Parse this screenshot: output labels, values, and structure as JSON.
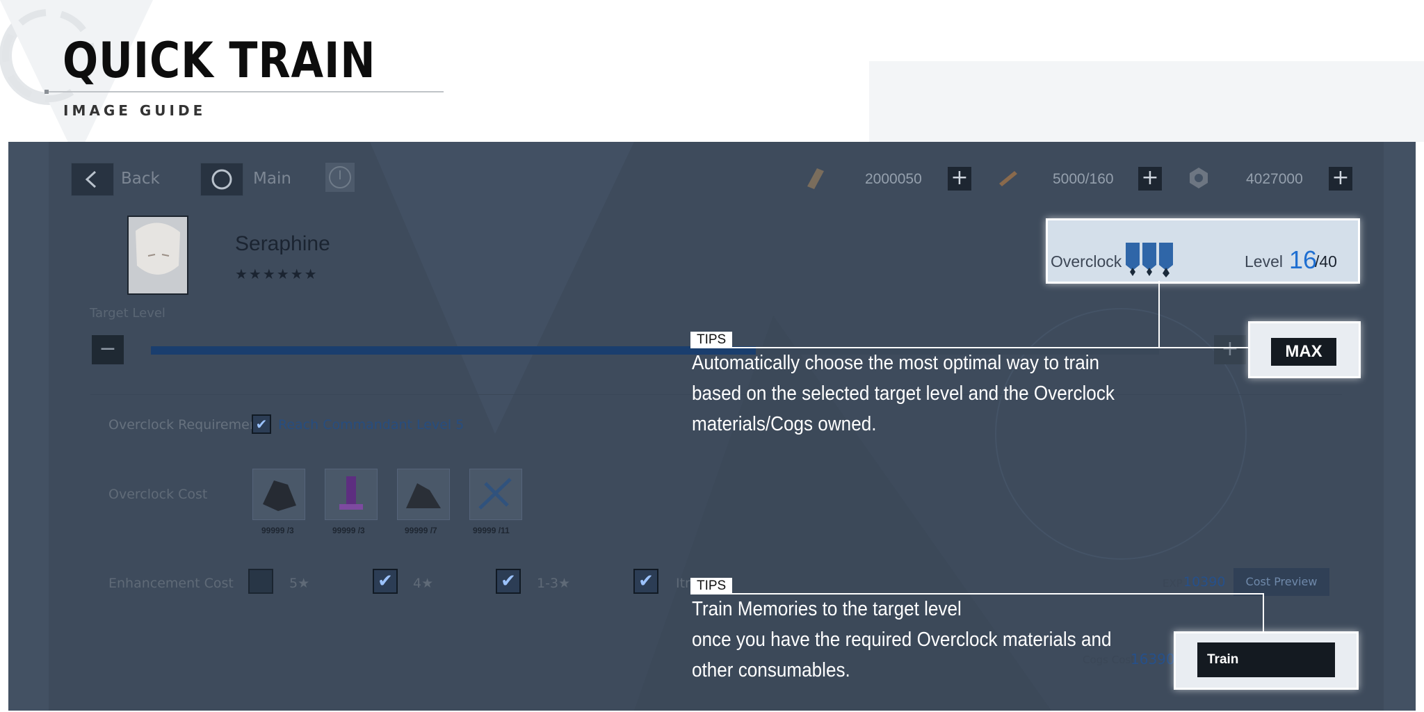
{
  "header": {
    "title": "QUICK TRAIN",
    "subtitle": "IMAGE GUIDE"
  },
  "topbar": {
    "back_label": "Back",
    "main_label": "Main",
    "resources": [
      {
        "icon": "ticket-icon",
        "value": "2000050"
      },
      {
        "icon": "battery-icon",
        "value": "5000/160"
      },
      {
        "icon": "cog-icon",
        "value": "4027000"
      }
    ]
  },
  "character": {
    "name": "Seraphine",
    "stars": "★★★★★★"
  },
  "overclock_badge": {
    "label": "Overclock",
    "level_label": "Level",
    "level": "16",
    "level_max": "/40"
  },
  "target_level": {
    "label": "Target Level",
    "minus": "−",
    "plus": "+",
    "max_label": "MAX",
    "fill_fraction": 0.6
  },
  "requirement": {
    "label": "Overclock Requirement",
    "value": "Reach Commandant Level 5"
  },
  "overclock_cost": {
    "label": "Overclock Cost",
    "items": [
      {
        "count": "99999",
        "need": "/3"
      },
      {
        "count": "99999",
        "need": "/3"
      },
      {
        "count": "99999",
        "need": "/7"
      },
      {
        "count": "99999",
        "need": "/11"
      }
    ]
  },
  "enhancement": {
    "label": "Enhancement Cost",
    "options": [
      {
        "label": "5★",
        "checked": false
      },
      {
        "label": "4★",
        "checked": true
      },
      {
        "label": "1-3★",
        "checked": true
      },
      {
        "label": "Itrial",
        "checked": true
      }
    ],
    "exp_label": "EXP",
    "exp_value": "10390",
    "cost_preview": "Cost Preview",
    "cogs_label": "Cogs Cost",
    "cogs_value": "163900"
  },
  "train_button": "Train",
  "tips": [
    {
      "tag": "TIPS",
      "lines": [
        "Automatically choose the most optimal way to train",
        "based on the selected target level and the Overclock",
        "materials/Cogs owned."
      ]
    },
    {
      "tag": "TIPS",
      "lines": [
        "Train Memories to the target level",
        "once you have the required Overclock materials and",
        "other consumables."
      ]
    }
  ],
  "colors": {
    "panel": "#435163",
    "accent": "#1f6fd1",
    "highlight": "#ffffff"
  }
}
